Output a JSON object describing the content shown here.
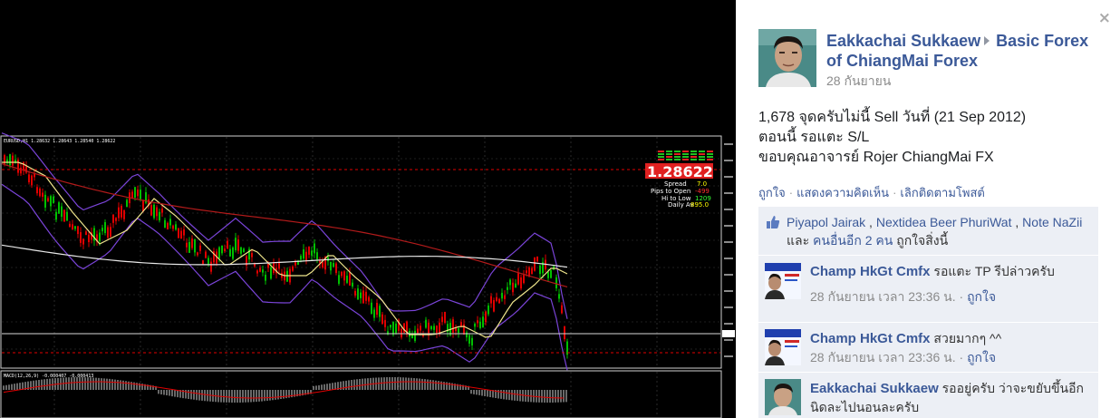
{
  "close": "×",
  "chart_header": {
    "title": "EURUSD,H1  1.28632 1.28643 1.28540 1.28622",
    "indicator": "MACD(12,26,9) -0.000407 -0.000413"
  },
  "chart_info": {
    "price": "1.28622",
    "rows": [
      {
        "label": "Spread",
        "value": "7.0"
      },
      {
        "label": "Pips to Open",
        "value": "-499"
      },
      {
        "label": "Hi to Low",
        "value": "1209"
      },
      {
        "label": "Daily Av",
        "value": "895.0"
      }
    ]
  },
  "colors": {
    "fb_blue": "#3b5998",
    "panel_bg": "#eceff5",
    "chart_bg": "#000000",
    "candle_up": "#00c000",
    "candle_down": "#e00000",
    "price_box": "#ff3030",
    "band": "#7a44d8"
  },
  "post": {
    "author": "Eakkachai Sukkaew",
    "group": "Basic Forex of ChiangMai Forex",
    "date": "28 กันยายน",
    "text_lines": [
      "1,678 จุดครับไม่นี้ Sell วันที่ (21 Sep 2012)",
      "ตอนนี้ รอแตะ S/L",
      "ขอบคุณอาจารย์ Rojer ChiangMai FX"
    ]
  },
  "actions": {
    "like": "ถูกใจ",
    "comment": "แสดงความคิดเห็น",
    "unfollow": "เลิกติดตามโพสต์"
  },
  "likes": {
    "person1": "Piyapol Jairak",
    "person2": "Nextidea Beer PhuriWat",
    "person3": "Note NaZii",
    "joiner": "และ",
    "others": "คนอื่นอีก 2 คน",
    "suffix": "ถูกใจสิ่งนี้"
  },
  "comments": [
    {
      "author": "Champ HkGt Cmfx",
      "text": "รอแตะ TP รีปล่าวครับ",
      "time": "28 กันยายน เวลา 23:36 น.",
      "like": "ถูกใจ"
    },
    {
      "author": "Champ HkGt Cmfx",
      "text": "สวยมากๆ ^^",
      "time": "28 กันยายน เวลา 23:36 น.",
      "like": "ถูกใจ"
    },
    {
      "author": "Eakkachai Sukkaew",
      "text": "รออยู่ครับ ว่าจะขยับขึ้นอีกนิดละไปนอนละครับ",
      "time": "",
      "like": ""
    }
  ]
}
